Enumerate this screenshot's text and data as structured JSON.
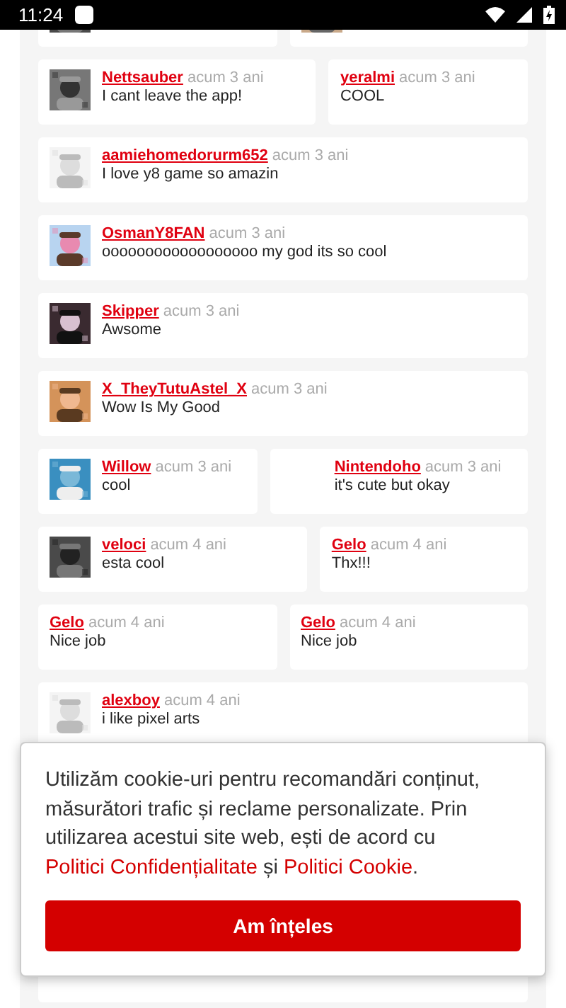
{
  "status_bar": {
    "time": "11:24"
  },
  "comment_rows": [
    {
      "comments": [
        {
          "kind": "avatar"
        },
        {
          "kind": "avatar"
        }
      ]
    },
    {
      "comments": [
        {
          "kind": "avatar",
          "user": "Nettsauber",
          "time": "acum 3 ani",
          "text": "I cant leave the app!"
        },
        {
          "kind": "plain",
          "user": "yeralmi",
          "time": "acum 3 ani",
          "text": "COOL"
        }
      ]
    },
    {
      "comments": [
        {
          "kind": "avatar",
          "user": "aamiehomedorurm652",
          "time": "acum 3 ani",
          "text": "I love y8 game so amazin"
        }
      ]
    },
    {
      "comments": [
        {
          "kind": "avatar",
          "user": "OsmanY8FAN",
          "time": "acum 3 ani",
          "text": "oooooooooooooooooo my god its so cool"
        }
      ]
    },
    {
      "comments": [
        {
          "kind": "avatar",
          "user": "Skipper",
          "time": "acum 3 ani",
          "text": "Awsome"
        }
      ]
    },
    {
      "comments": [
        {
          "kind": "avatar",
          "user": "X_TheyTutuAstel_X",
          "time": "acum 3 ani",
          "text": "Wow Is My Good"
        }
      ]
    },
    {
      "comments": [
        {
          "kind": "avatar",
          "user": "Willow",
          "time": "acum 3 ani",
          "text": "cool"
        },
        {
          "kind": "indented",
          "user": "Nintendoho",
          "time": "acum 3 ani",
          "text": "it's cute but okay"
        }
      ]
    },
    {
      "comments": [
        {
          "kind": "avatar",
          "user": "veloci",
          "time": "acum 4 ani",
          "text": "esta cool"
        },
        {
          "kind": "plain",
          "user": "Gelo",
          "time": "acum 4 ani",
          "text": "Thx!!!"
        }
      ]
    },
    {
      "comments": [
        {
          "kind": "plain",
          "user": "Gelo",
          "time": "acum 4 ani",
          "text": "Nice job"
        },
        {
          "kind": "plain",
          "user": "Gelo",
          "time": "acum 4 ani",
          "text": "Nice job"
        }
      ]
    },
    {
      "comments": [
        {
          "kind": "avatar",
          "user": "alexboy",
          "time": "acum 4 ani",
          "text": "i like pixel arts"
        }
      ]
    },
    {
      "comments": [
        {
          "kind": "plain"
        }
      ]
    }
  ],
  "cookie_banner": {
    "text_before": "Utilizăm cookie-uri pentru recomandări conținut, măsurători trafic și reclame personalizate. Prin utilizarea acestui site web, ești de acord cu ",
    "privacy_link": "Politici Confidențialitate",
    "conjunction": " și ",
    "cookie_link": "Politici Cookie",
    "text_after": ".",
    "button": "Am înțeles"
  }
}
